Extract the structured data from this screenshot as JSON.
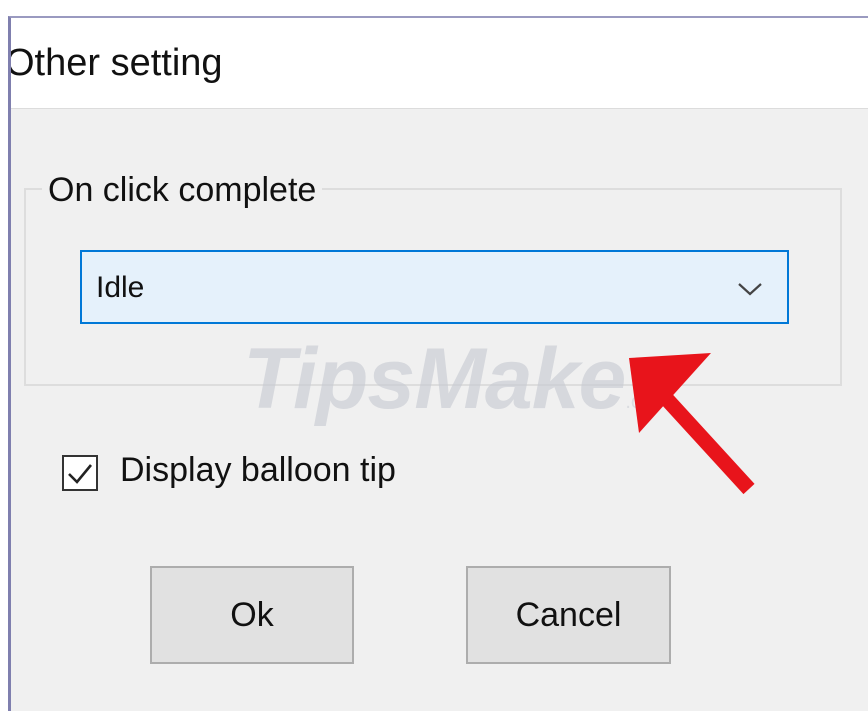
{
  "window": {
    "title": "Other setting"
  },
  "group": {
    "label": "On click complete",
    "select": {
      "value": "Idle",
      "icon": "chevron-down-icon"
    }
  },
  "options": {
    "balloon_tip": {
      "label": "Display balloon tip",
      "checked": true
    }
  },
  "buttons": {
    "ok_label": "Ok",
    "cancel_label": "Cancel"
  },
  "watermark": {
    "text": "TipsMake",
    "suffix": ".com"
  },
  "annotation": {
    "arrow_color": "#e8141b"
  },
  "colors": {
    "accent": "#0078d7",
    "combo_bg": "#e5f1fb",
    "dialog_bg": "#f0f0f0",
    "button_bg": "#e1e1e1"
  }
}
